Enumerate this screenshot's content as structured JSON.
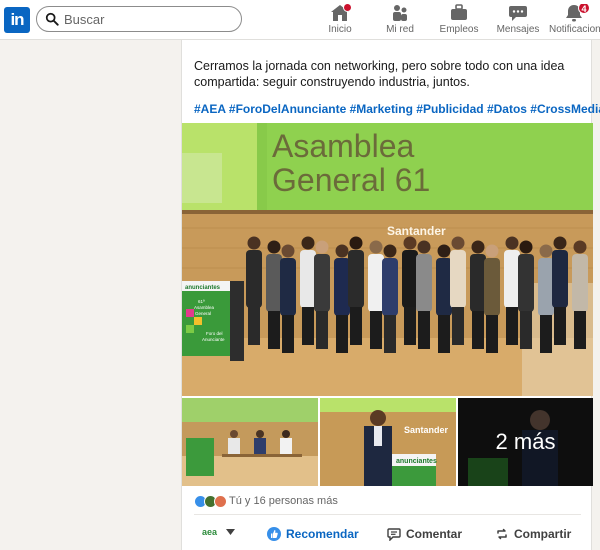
{
  "nav": {
    "logo": "in",
    "search_placeholder": "Buscar",
    "items": [
      {
        "label": "Inicio",
        "icon": "home-icon",
        "badge": ""
      },
      {
        "label": "Mi red",
        "icon": "network-icon",
        "badge": ""
      },
      {
        "label": "Empleos",
        "icon": "briefcase-icon",
        "badge": ""
      },
      {
        "label": "Mensajes",
        "icon": "messaging-icon",
        "badge": ""
      },
      {
        "label": "Notificaciones",
        "icon": "bell-icon",
        "badge": "4"
      }
    ]
  },
  "post": {
    "text": "Cerramos la jornada con networking, pero sobre todo con una idea compartida: seguir construyendo industria, juntos.",
    "hashtags": "#AEA #ForoDelAnunciante #Marketing #Publicidad #Datos #CrossMedia",
    "photo": {
      "banner_title_line1": "Asamblea",
      "banner_title_line2": "General 61",
      "wall_brand": "Santander",
      "sign_brand": "anunciantes",
      "sign_line1": "61ª",
      "sign_line2": "Asamblea",
      "sign_line3": "General",
      "sign_line4": "Foro del",
      "sign_line5": "Anunciante"
    },
    "thumb3_brand": "Santander",
    "thumb3_sign": "anunciantes",
    "more_label": "2 más",
    "reactions_text": "Tú y 16 personas más",
    "actions": {
      "brand": "aea",
      "like": "Recomendar",
      "comment": "Comentar",
      "share": "Compartir"
    }
  },
  "colors": {
    "accent": "#0a66c2",
    "banner_green": "#8fd14f",
    "badge_red": "#cb112d"
  }
}
